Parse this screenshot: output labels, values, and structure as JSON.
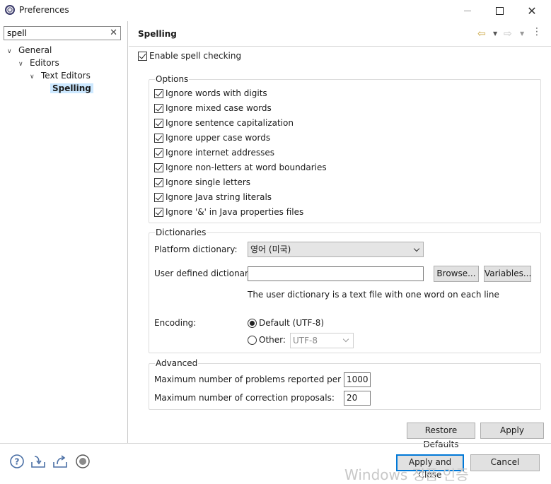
{
  "window": {
    "title": "Preferences"
  },
  "sidebar": {
    "filter_value": "spell",
    "tree": [
      {
        "label": "General",
        "level": 0,
        "expanded": true
      },
      {
        "label": "Editors",
        "level": 1,
        "expanded": true
      },
      {
        "label": "Text Editors",
        "level": 2,
        "expanded": true
      },
      {
        "label": "Spelling",
        "level": 3,
        "selected": true
      }
    ]
  },
  "page": {
    "title": "Spelling",
    "enable_spell_checking": {
      "label": "Enable spell checking",
      "checked": true
    }
  },
  "options": {
    "title": "Options",
    "items": [
      {
        "label": "Ignore words with digits",
        "checked": true
      },
      {
        "label": "Ignore mixed case words",
        "checked": true
      },
      {
        "label": "Ignore sentence capitalization",
        "checked": true
      },
      {
        "label": "Ignore upper case words",
        "checked": true
      },
      {
        "label": "Ignore internet addresses",
        "checked": true
      },
      {
        "label": "Ignore non-letters at word boundaries",
        "checked": true
      },
      {
        "label": "Ignore single letters",
        "checked": true
      },
      {
        "label": "Ignore Java string literals",
        "checked": true
      },
      {
        "label": "Ignore '&' in Java properties files",
        "checked": true
      }
    ]
  },
  "dictionaries": {
    "title": "Dictionaries",
    "platform_label": "Platform dictionary:",
    "platform_value": "영어 (미국)",
    "user_label": "User defined dictionary:",
    "user_value": "",
    "browse_label": "Browse...",
    "variables_label": "Variables...",
    "hint": "The user dictionary is a text file with one word on each line",
    "encoding_label": "Encoding:",
    "default_label": "Default (UTF-8)",
    "other_label": "Other:",
    "other_value": "UTF-8",
    "encoding_selected": "default"
  },
  "advanced": {
    "title": "Advanced",
    "max_problems_label": "Maximum number of problems reported per file:",
    "max_problems_value": "1000",
    "max_proposals_label": "Maximum number of correction proposals:",
    "max_proposals_value": "20"
  },
  "buttons": {
    "restore_defaults": "Restore Defaults",
    "apply": "Apply",
    "apply_and_close": "Apply and Close",
    "cancel": "Cancel"
  },
  "watermark": "Windows 정품 인증",
  "icons": {
    "help": "help-icon",
    "import": "import-icon",
    "export": "export-icon",
    "record": "oomph-record-icon"
  },
  "colors": {
    "accent": "#0078d7",
    "selection": "#cce8ff"
  }
}
